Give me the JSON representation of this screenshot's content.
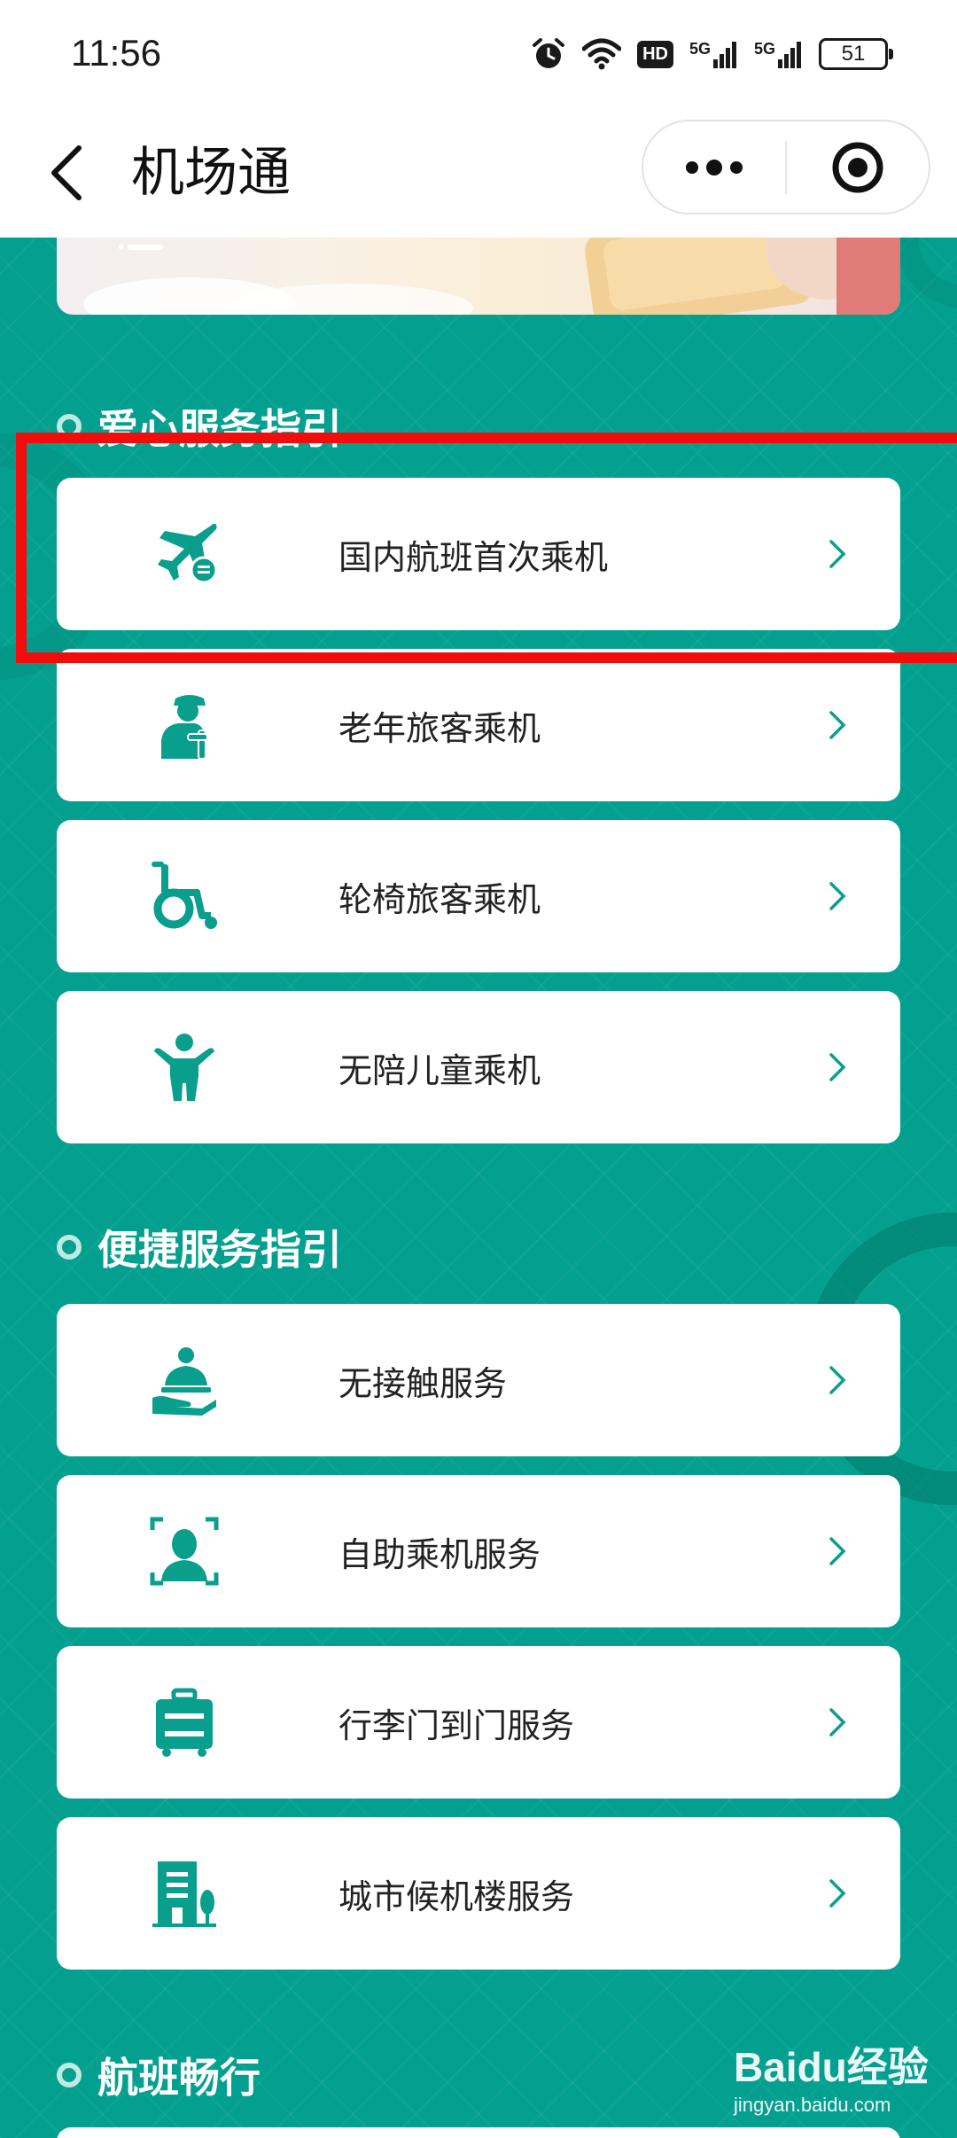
{
  "status_bar": {
    "time": "11:56",
    "network_1": "5G",
    "network_2": "5G",
    "hd_label": "HD",
    "battery": "51"
  },
  "nav": {
    "title": "机场通",
    "more_icon": "more-dots-icon",
    "close_icon": "target-close-icon"
  },
  "sections": [
    {
      "title": "爱心服务指引",
      "items": [
        {
          "label": "国内航班首次乘机",
          "icon": "airplane-icon"
        },
        {
          "label": "老年旅客乘机",
          "icon": "elderly-icon"
        },
        {
          "label": "轮椅旅客乘机",
          "icon": "wheelchair-icon"
        },
        {
          "label": "无陪儿童乘机",
          "icon": "child-icon"
        }
      ]
    },
    {
      "title": "便捷服务指引",
      "items": [
        {
          "label": "无接触服务",
          "icon": "service-hand-icon"
        },
        {
          "label": "自助乘机服务",
          "icon": "face-scan-icon"
        },
        {
          "label": "行李门到门服务",
          "icon": "luggage-icon"
        },
        {
          "label": "城市候机楼服务",
          "icon": "building-icon"
        }
      ]
    },
    {
      "title": "航班畅行",
      "items": []
    }
  ],
  "watermark": {
    "logo": "Baidu经验",
    "url": "jingyan.baidu.com"
  },
  "colors": {
    "background": "#04a08f",
    "accent": "#0a9e8c",
    "highlight": "#f20d0d"
  }
}
